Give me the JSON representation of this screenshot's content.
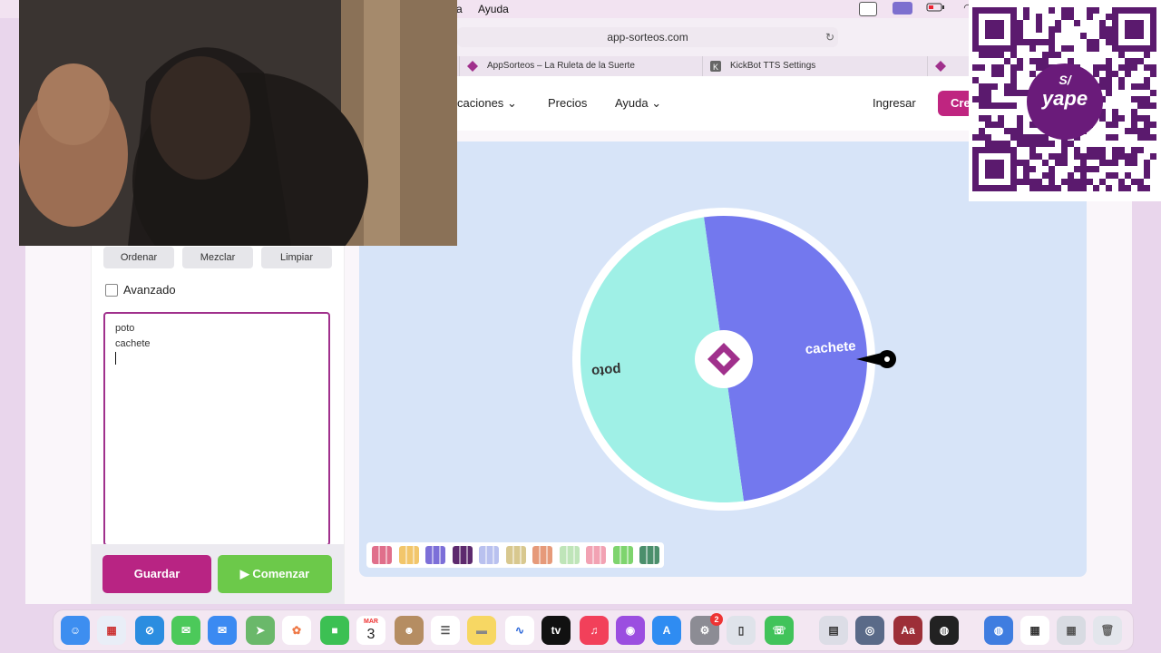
{
  "menubar": {
    "help": "Ayuda",
    "partial": "a"
  },
  "browser": {
    "url": "app-sorteos.com",
    "tabs": [
      {
        "label": "AppSorteos – La Ruleta de la Suerte"
      },
      {
        "label": "KickBot TTS Settings"
      }
    ]
  },
  "site_nav": {
    "aplicaciones": "caciones",
    "precios": "Precios",
    "ayuda": "Ayuda",
    "ingresar": "Ingresar",
    "crear": "Cre"
  },
  "panel": {
    "ordenar": "Ordenar",
    "mezclar": "Mezclar",
    "limpiar": "Limpiar",
    "avanzado": "Avanzado",
    "entries": [
      "poto",
      "cachete"
    ],
    "guardar": "Guardar",
    "comenzar": "Comenzar"
  },
  "wheel": {
    "segments": [
      {
        "label": "cachete",
        "color": "#7378ee"
      },
      {
        "label": "poto",
        "color": "#9ff0e6"
      }
    ]
  },
  "palette_colors": [
    "#e06f8b",
    "#f2c66b",
    "#7c6fd8",
    "#5d2a6e",
    "#b9c1ef",
    "#d8c88f",
    "#e69a7a",
    "#bfe5b9",
    "#f2a2b3",
    "#7ed46e",
    "#4b8f6c"
  ],
  "dock": {
    "calendar_month": "MAR",
    "calendar_day": "3",
    "settings_badge": "2",
    "appletv": "tv",
    "dictionary": "Aa"
  },
  "qr": {
    "badge_currency": "S/",
    "badge_brand": "yape"
  }
}
